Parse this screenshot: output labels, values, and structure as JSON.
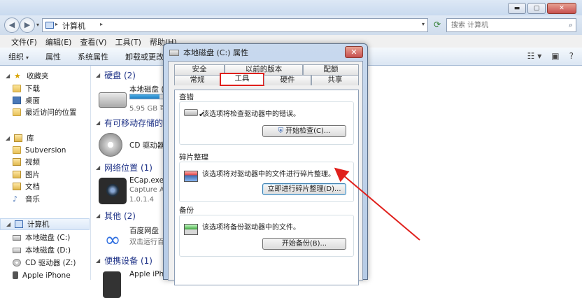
{
  "window": {
    "min_glyph": "▬",
    "max_glyph": "▢",
    "close_glyph": "✕"
  },
  "address": {
    "back_glyph": "◀",
    "forward_glyph": "▶",
    "path": "计算机",
    "sep": "▸",
    "dropdown": "▾",
    "refresh_glyph": "⟳"
  },
  "search": {
    "placeholder": "搜索 计算机",
    "icon": "search-icon",
    "glyph": "⌕"
  },
  "menu": [
    "文件(F)",
    "编辑(E)",
    "查看(V)",
    "工具(T)",
    "帮助(H)"
  ],
  "toolbar": {
    "organize": "组织",
    "organize_tri": "▾",
    "properties": "属性",
    "system_props": "系统属性",
    "uninstall": "卸载或更改程序",
    "view_glyph": "☷",
    "view_tri": "▾",
    "pane_glyph": "▣",
    "help_glyph": "?"
  },
  "nav": {
    "favorites": "收藏夹",
    "downloads": "下载",
    "desktop": "桌面",
    "recent": "最近访问的位置",
    "library": "库",
    "subversion": "Subversion",
    "videos": "视频",
    "pictures": "图片",
    "documents": "文档",
    "music": "音乐",
    "computer": "计算机",
    "drive_c": "本地磁盘 (C:)",
    "drive_d": "本地磁盘 (D:)",
    "cd_drive": "CD 驱动器 (Z:)",
    "iphone": "Apple iPhone",
    "star": "★",
    "note": "♪",
    "tri_open": "◢",
    "tri_closed": "▷"
  },
  "content": {
    "groups": {
      "hdd": "硬盘 (2)",
      "removable": "有可移动存储的设",
      "network": "网络位置 (1)",
      "other": "其他 (2)",
      "portable": "便携设备 (1)"
    },
    "items": {
      "drive_c_name": "本地磁盘 (C",
      "drive_c_free": "5.95 GB 可",
      "cd_name": "CD 驱动器",
      "ecap_name": "ECap.exe",
      "ecap_sub1": "Capture Ap",
      "ecap_sub2": "1.0.1.4",
      "baidu_name": "百度网盘",
      "baidu_sub": "双击运行百",
      "iphone_name": "Apple iPho",
      "baidu_glyph": "∞"
    },
    "drive_c_usage": 0.8
  },
  "dialog": {
    "title": "本地磁盘 (C:) 属性",
    "close_glyph": "✕",
    "tabs_row1": [
      "安全",
      "以前的版本",
      "配额"
    ],
    "tabs_row2": [
      "常规",
      "工具",
      "硬件",
      "共享"
    ],
    "check": {
      "title": "查错",
      "text": "该选项将检查驱动器中的错误。",
      "button": "开始检查(C)..."
    },
    "defrag": {
      "title": "碎片整理",
      "text": "该选项将对驱动器中的文件进行碎片整理。",
      "button": "立即进行碎片整理(D)..."
    },
    "backup": {
      "title": "备份",
      "text": "该选项将备份驱动器中的文件。",
      "button": "开始备份(B)..."
    },
    "shield_glyph": "⛨",
    "check_glyph": "✔"
  },
  "colors": {
    "annotation": "#e0201c",
    "group_text": "#1e3287"
  }
}
